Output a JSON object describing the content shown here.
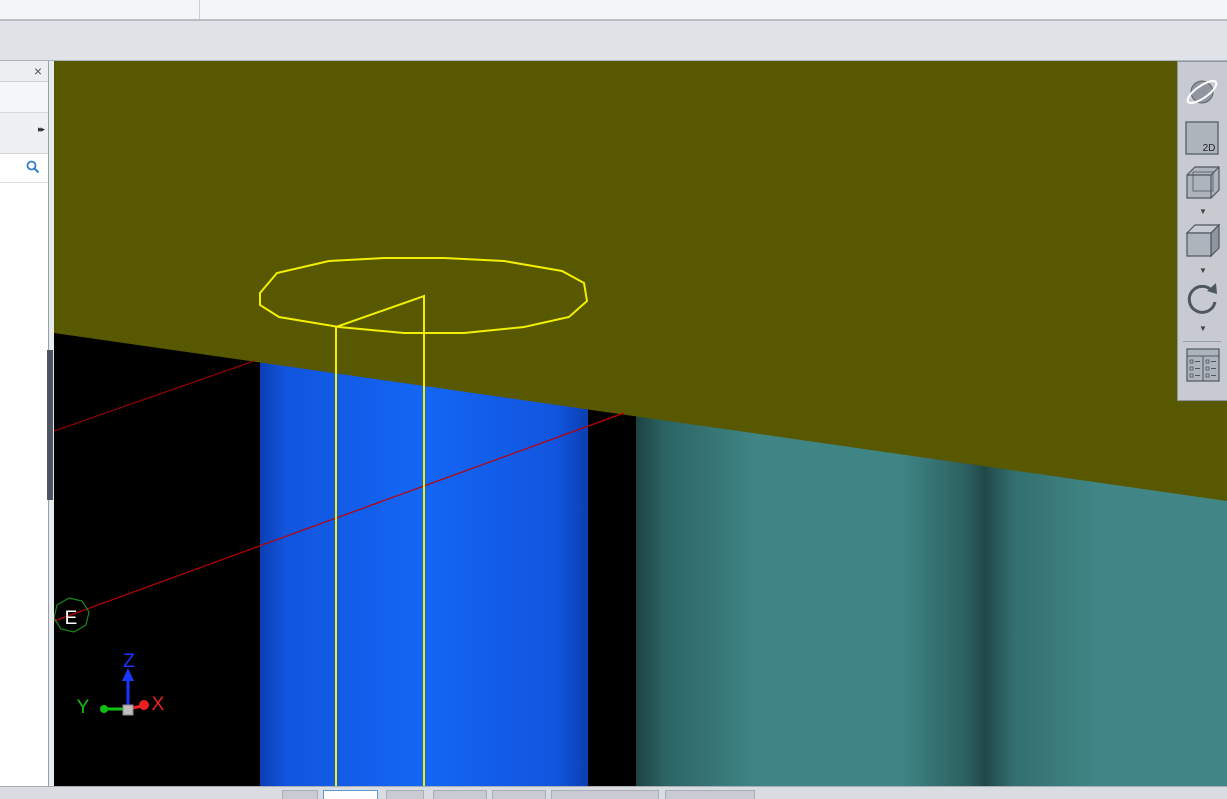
{
  "left_panel": {
    "close_glyph": "×",
    "expand_glyph": "▸▸"
  },
  "navigation_toolbar": {
    "buttons": [
      {
        "icon": "orbit-globe-icon"
      },
      {
        "icon": "view-2d-icon",
        "label": "2D"
      },
      {
        "icon": "wireframe-cube-icon"
      },
      {
        "icon": "shaded-cube-icon"
      },
      {
        "icon": "rotate-icon"
      },
      {
        "icon": "checklist-icon"
      }
    ]
  },
  "viewport": {
    "colors": {
      "ground_plane": "#585800",
      "background": "#000000",
      "cylinder_blue": "#1466f5",
      "cylinder_teal": "#3f8585",
      "wire_yellow": "#f0f000",
      "axis_red": "#c00000"
    },
    "marker_label": "E",
    "axis_triad": {
      "x_label": "X",
      "y_label": "Y",
      "z_label": "Z"
    }
  }
}
